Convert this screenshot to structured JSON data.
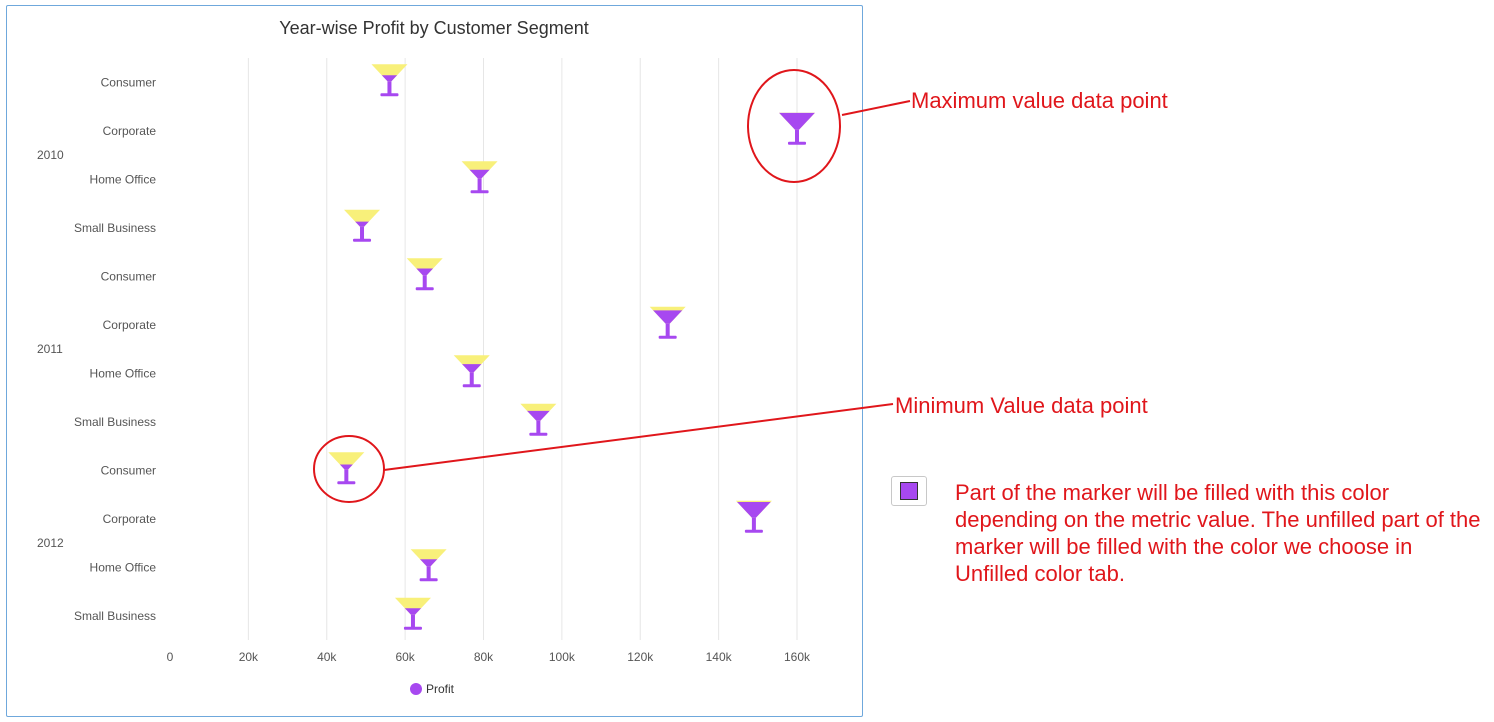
{
  "chart_data": {
    "type": "scatter",
    "title": "Year-wise Profit by Customer Segment",
    "xlabel": "",
    "ylabel": "",
    "xlim": [
      0,
      175000
    ],
    "x_ticks": [
      "0",
      "20k",
      "40k",
      "60k",
      "80k",
      "100k",
      "120k",
      "140k",
      "160k"
    ],
    "x_tick_values": [
      0,
      20000,
      40000,
      60000,
      80000,
      100000,
      120000,
      140000,
      160000
    ],
    "grid": "vertical",
    "legend": "bottom",
    "marker": "martini-glass",
    "groups": [
      "2010",
      "2011",
      "2012"
    ],
    "categories": [
      "Consumer",
      "Corporate",
      "Home Office",
      "Small Business"
    ],
    "series": [
      {
        "name": "Profit",
        "points": [
          {
            "group": "2010",
            "category": "Consumer",
            "value": 56000,
            "fill": 0.35
          },
          {
            "group": "2010",
            "category": "Corporate",
            "value": 160000,
            "fill": 1.0
          },
          {
            "group": "2010",
            "category": "Home Office",
            "value": 79000,
            "fill": 0.5
          },
          {
            "group": "2010",
            "category": "Small Business",
            "value": 49000,
            "fill": 0.3
          },
          {
            "group": "2011",
            "category": "Consumer",
            "value": 65000,
            "fill": 0.4
          },
          {
            "group": "2011",
            "category": "Corporate",
            "value": 127000,
            "fill": 0.79
          },
          {
            "group": "2011",
            "category": "Home Office",
            "value": 77000,
            "fill": 0.48
          },
          {
            "group": "2011",
            "category": "Small Business",
            "value": 94000,
            "fill": 0.58
          },
          {
            "group": "2012",
            "category": "Consumer",
            "value": 45000,
            "fill": 0.28
          },
          {
            "group": "2012",
            "category": "Corporate",
            "value": 149000,
            "fill": 0.93
          },
          {
            "group": "2012",
            "category": "Home Office",
            "value": 66000,
            "fill": 0.41
          },
          {
            "group": "2012",
            "category": "Small Business",
            "value": 62000,
            "fill": 0.38
          }
        ]
      }
    ],
    "colors": {
      "filled": "#a748f0",
      "unfilled": "#f8f07a",
      "grid": "#e6e6e6",
      "label": "#555555"
    }
  },
  "annotations": {
    "max_label": "Maximum value data point",
    "min_label": "Minimum Value data point",
    "note": "Part of the marker will be filled with this color depending on the metric value. The unfilled part of the marker will be filled with the color we choose in Unfilled color tab.",
    "color": "#e0161b",
    "swatch_color": "#a748f0"
  }
}
